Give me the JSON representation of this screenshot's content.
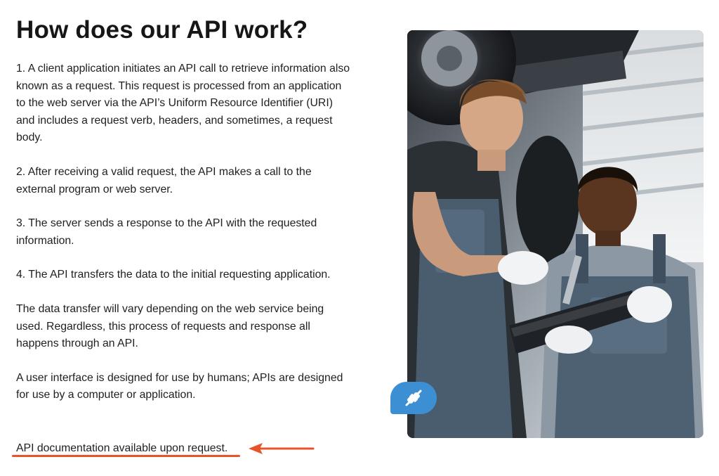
{
  "heading": "How does our API work?",
  "paragraphs": [
    "1. A client application initiates an API call to retrieve information also known as a request. This request is processed from an application to the web server via the API’s Uniform Resource Identifier (URI) and includes a request verb, headers, and sometimes, a request body.",
    "2. After receiving a valid request, the API makes a call to the external program or web server.",
    "3. The server sends a response to the API with the requested information.",
    "4. The API transfers the data to the initial requesting application.",
    "The data transfer will vary depending on the web service being used. Regardless, this process of requests and response all happens through an API.",
    "A user interface is designed for use by humans; APIs are designed for use by a computer or application."
  ],
  "footer_note": "API documentation available upon request.",
  "colors": {
    "accent": "#e8532a",
    "badge": "#3d8fd4"
  },
  "icons": {
    "badge_icon": "plug-icon",
    "annotation_arrow": "arrow-left-icon"
  }
}
